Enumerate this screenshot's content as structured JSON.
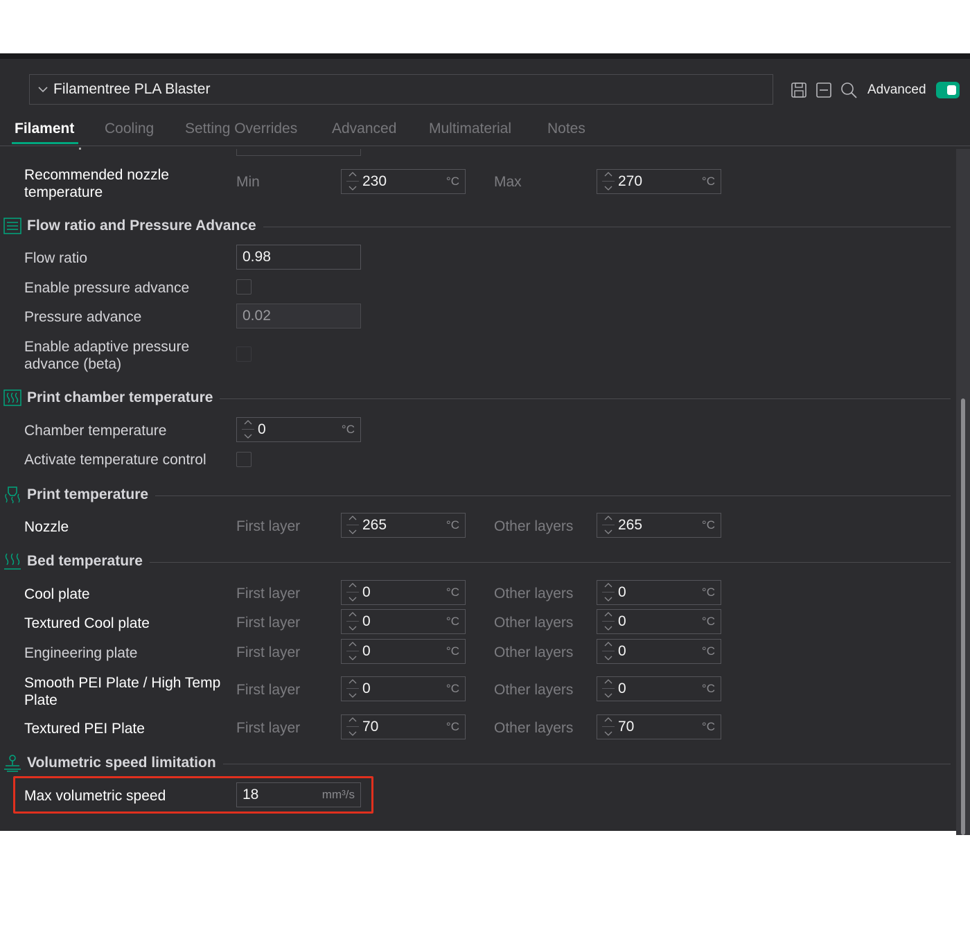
{
  "preset": {
    "name": "Filamentree PLA Blaster"
  },
  "toolbar": {
    "advanced_label": "Advanced",
    "advanced_on": true,
    "icons": [
      "save-icon",
      "compare-icon",
      "search-icon"
    ]
  },
  "tabs": [
    {
      "label": "Filament",
      "active": true
    },
    {
      "label": "Cooling"
    },
    {
      "label": "Setting Overrides"
    },
    {
      "label": "Advanced"
    },
    {
      "label": "Multimaterial"
    },
    {
      "label": "Notes"
    }
  ],
  "units": {
    "celsius": "°C",
    "volumetric": "mm³/s"
  },
  "recommended_nozzle": {
    "label": "Recommended nozzle temperature",
    "min_label": "Min",
    "min_value": "230",
    "max_label": "Max",
    "max_value": "270"
  },
  "flow_section": {
    "title": "Flow ratio and Pressure Advance",
    "flow_ratio": {
      "label": "Flow ratio",
      "value": "0.98"
    },
    "enable_pa": {
      "label": "Enable pressure advance",
      "checked": false
    },
    "pa": {
      "label": "Pressure advance",
      "value": "0.02"
    },
    "adaptive_pa": {
      "label": "Enable adaptive pressure advance (beta)",
      "checked": false
    }
  },
  "chamber_section": {
    "title": "Print chamber temperature",
    "chamber_temp": {
      "label": "Chamber temperature",
      "value": "0"
    },
    "activate_control": {
      "label": "Activate temperature control",
      "checked": false
    }
  },
  "print_temp_section": {
    "title": "Print temperature",
    "nozzle": {
      "label": "Nozzle",
      "first_label": "First layer",
      "first": "265",
      "other_label": "Other layers",
      "other": "265"
    }
  },
  "bed_section": {
    "title": "Bed temperature",
    "first_label": "First layer",
    "other_label": "Other layers",
    "plates": [
      {
        "label": "Cool plate",
        "first": "0",
        "other": "0"
      },
      {
        "label": "Textured Cool plate",
        "first": "0",
        "other": "0"
      },
      {
        "label": "Engineering plate",
        "first": "0",
        "other": "0"
      },
      {
        "label": "Smooth PEI Plate / High Temp Plate",
        "first": "0",
        "other": "0"
      },
      {
        "label": "Textured PEI Plate",
        "first": "70",
        "other": "70"
      }
    ]
  },
  "volumetric_section": {
    "title": "Volumetric speed limitation",
    "max_speed": {
      "label": "Max volumetric speed",
      "value": "18"
    }
  },
  "colors": {
    "accent": "#00a67e",
    "highlight": "#e0301e",
    "panel": "#2c2c2f"
  }
}
